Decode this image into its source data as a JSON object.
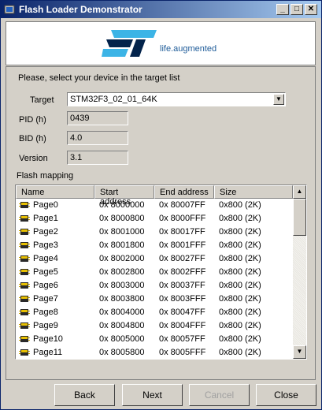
{
  "window": {
    "title": "Flash Loader Demonstrator"
  },
  "logo": {
    "tagline": "life.augmented",
    "brand_color": "#03234b",
    "accent_color": "#3cb4e6"
  },
  "instruction": "Please, select your device in the target list",
  "target": {
    "label": "Target",
    "value": "STM32F3_02_01_64K"
  },
  "pid": {
    "label": "PID  (h)",
    "value": "0439"
  },
  "bid": {
    "label": "BID  (h)",
    "value": "4.0"
  },
  "version": {
    "label": "Version",
    "value": "3.1"
  },
  "flash_mapping": {
    "label": "Flash mapping",
    "columns": [
      "Name",
      "Start address",
      "End address",
      "Size"
    ],
    "rows": [
      [
        "Page0",
        "0x 8000000",
        "0x 80007FF",
        "0x800 (2K)"
      ],
      [
        "Page1",
        "0x 8000800",
        "0x 8000FFF",
        "0x800 (2K)"
      ],
      [
        "Page2",
        "0x 8001000",
        "0x 80017FF",
        "0x800 (2K)"
      ],
      [
        "Page3",
        "0x 8001800",
        "0x 8001FFF",
        "0x800 (2K)"
      ],
      [
        "Page4",
        "0x 8002000",
        "0x 80027FF",
        "0x800 (2K)"
      ],
      [
        "Page5",
        "0x 8002800",
        "0x 8002FFF",
        "0x800 (2K)"
      ],
      [
        "Page6",
        "0x 8003000",
        "0x 80037FF",
        "0x800 (2K)"
      ],
      [
        "Page7",
        "0x 8003800",
        "0x 8003FFF",
        "0x800 (2K)"
      ],
      [
        "Page8",
        "0x 8004000",
        "0x 80047FF",
        "0x800 (2K)"
      ],
      [
        "Page9",
        "0x 8004800",
        "0x 8004FFF",
        "0x800 (2K)"
      ],
      [
        "Page10",
        "0x 8005000",
        "0x 80057FF",
        "0x800 (2K)"
      ],
      [
        "Page11",
        "0x 8005800",
        "0x 8005FFF",
        "0x800 (2K)"
      ]
    ]
  },
  "buttons": {
    "back": "Back",
    "next": "Next",
    "cancel": "Cancel",
    "close": "Close"
  }
}
